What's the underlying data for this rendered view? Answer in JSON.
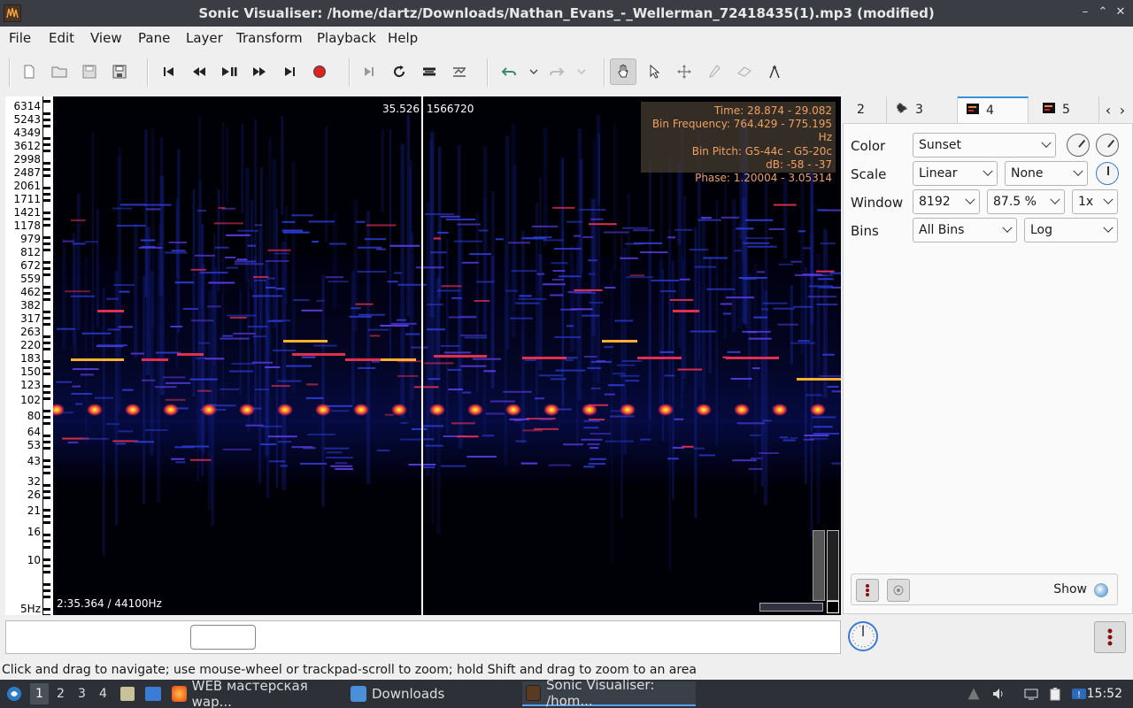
{
  "window": {
    "title": "Sonic Visualiser: /home/dartz/Downloads/Nathan_Evans_-_Wellerman_72418435(1).mp3 (modified)",
    "controls": [
      "–",
      "⌃",
      "✕"
    ]
  },
  "menu": [
    "File",
    "Edit",
    "View",
    "Pane",
    "Layer",
    "Transform",
    "Playback",
    "Help"
  ],
  "toolbar": {
    "icons": [
      "new-file-icon",
      "open-folder-icon",
      "save-icon",
      "save-as-icon",
      "rewind-start-icon",
      "rewind-icon",
      "play-pause-icon",
      "fast-forward-icon",
      "forward-end-icon",
      "record-icon",
      "play-selection-icon",
      "loop-icon",
      "solo-icon",
      "normalize-icon",
      "undo-icon",
      "redo-icon",
      "navigate-hand-icon",
      "select-arrow-icon",
      "move-icon",
      "draw-pencil-icon",
      "erase-icon",
      "measure-icon"
    ],
    "active_tool": "navigate-hand-icon"
  },
  "pane": {
    "freq_ticks": [
      "6314",
      "5243",
      "4349",
      "3612",
      "2998",
      "2487",
      "2061",
      "1711",
      "1421",
      "1178",
      "979",
      "812",
      "672",
      "559",
      "462",
      "382",
      "317",
      "263",
      "220",
      "183",
      "150",
      "123",
      "102",
      "80",
      "64",
      "53",
      "43",
      "32",
      "26",
      "21",
      "16",
      "10",
      "5Hz"
    ],
    "cursor_time": "35.526",
    "cursor_frame": "1566720",
    "duration_label": "2:35.364 / 44100Hz",
    "info": {
      "time": "Time: 28.874 - 29.082",
      "bin_frequency": "Bin Frequency: 764.429 - 775.195 Hz",
      "bin_pitch": "Bin Pitch: G5-44c - G5-20c",
      "db": "dB: -58 - -37",
      "phase": "Phase: 1.20004 - 3.05314"
    }
  },
  "right_panel": {
    "tabs": [
      {
        "label": "2",
        "icon": ""
      },
      {
        "label": "3",
        "icon": "waveform-icon"
      },
      {
        "label": "4",
        "icon": "spectrogram-icon"
      },
      {
        "label": "5",
        "icon": "spectrogram-icon"
      }
    ],
    "active_tab": "4",
    "properties": {
      "color_label": "Color",
      "color_value": "Sunset",
      "scale_label": "Scale",
      "scale_value": "Linear",
      "scale_norm": "None",
      "window_label": "Window",
      "window_size": "8192",
      "window_overlap": "87.5 %",
      "window_oversample": "1x",
      "bins_label": "Bins",
      "bins_value": "All Bins",
      "bins_scale": "Log"
    },
    "show_label": "Show"
  },
  "status_text": "Click and drag to navigate; use mouse-wheel or trackpad-scroll to zoom; hold Shift and drag to zoom to an area",
  "taskbar": {
    "workspaces": [
      "1",
      "2",
      "3",
      "4"
    ],
    "active_workspace": "1",
    "tasks": [
      {
        "label": "WEB мастерская wap...",
        "icon": "firefox-icon"
      },
      {
        "label": "Downloads",
        "icon": "folder-icon"
      },
      {
        "label": "Sonic Visualiser: /hom...",
        "icon": "sonic-visualiser-icon"
      }
    ],
    "clock": "15:52"
  },
  "colors": {
    "accent": "#3a8fd8",
    "spectro_bg": "#000007",
    "info_text": "#f0a060"
  }
}
